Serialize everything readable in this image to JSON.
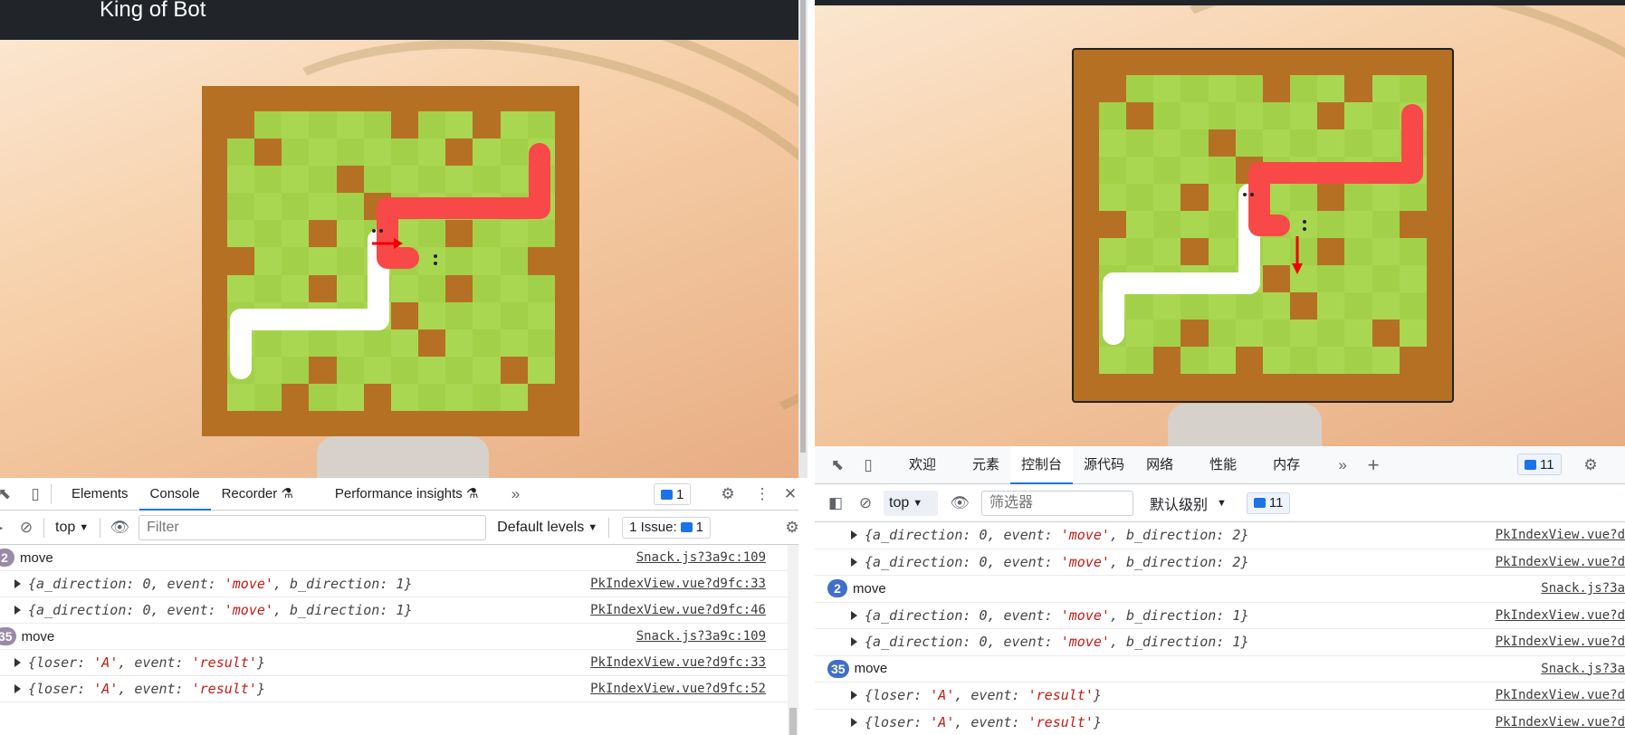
{
  "left": {
    "navbar_brand": "King of Bot",
    "devtools": {
      "tabs": [
        "Elements",
        "Console",
        "Recorder",
        "Performance insights"
      ],
      "issues_count": "1",
      "context": "top",
      "filter_placeholder": "Filter",
      "levels": "Default levels",
      "issues_label": "1 Issue:",
      "issues_badge": "1",
      "rows": [
        {
          "count": "2",
          "text": "move",
          "src": "Snack.js?3a9c:109"
        },
        {
          "obj": [
            "a_direction",
            "0",
            "move",
            "b_direction",
            "1"
          ],
          "src": "PkIndexView.vue?d9fc:33"
        },
        {
          "obj": [
            "a_direction",
            "0",
            "move",
            "b_direction",
            "1"
          ],
          "src": "PkIndexView.vue?d9fc:46"
        },
        {
          "count": "35",
          "text": "move",
          "src": "Snack.js?3a9c:109"
        },
        {
          "res": [
            "loser",
            "A",
            "result"
          ],
          "src": "PkIndexView.vue?d9fc:33"
        },
        {
          "res": [
            "loser",
            "A",
            "result"
          ],
          "src": "PkIndexView.vue?d9fc:52"
        }
      ]
    }
  },
  "right": {
    "devtools": {
      "tabs": [
        "欢迎",
        "元素",
        "控制台",
        "源代码",
        "网络",
        "性能",
        "内存"
      ],
      "issues_count": "11",
      "context": "top",
      "filter_placeholder": "筛选器",
      "levels": "默认级别",
      "msg_count": "11",
      "rows": [
        {
          "obj": [
            "a_direction",
            "0",
            "move",
            "b_direction",
            "2"
          ],
          "src": "PkIndexView.vue?d"
        },
        {
          "obj": [
            "a_direction",
            "0",
            "move",
            "b_direction",
            "2"
          ],
          "src": "PkIndexView.vue?d"
        },
        {
          "count": "2",
          "text": "move",
          "src": "Snack.js?3a"
        },
        {
          "obj": [
            "a_direction",
            "0",
            "move",
            "b_direction",
            "1"
          ],
          "src": "PkIndexView.vue?d"
        },
        {
          "obj": [
            "a_direction",
            "0",
            "move",
            "b_direction",
            "1"
          ],
          "src": "PkIndexView.vue?d"
        },
        {
          "count": "35",
          "text": "move",
          "src": "Snack.js?3a"
        },
        {
          "res": [
            "loser",
            "A",
            "result"
          ],
          "src": "PkIndexView.vue?d"
        },
        {
          "res": [
            "loser",
            "A",
            "result"
          ],
          "src": "PkIndexView.vue?d"
        }
      ]
    }
  },
  "colors": {
    "wall": "#b57024",
    "grass_light": "#aad751",
    "grass_dark": "#a2d149",
    "snake_a": "#ffffff",
    "snake_b": "#f94848",
    "accent": "#1a73e8"
  },
  "icons": [
    "inspect-icon",
    "device-icon",
    "more-tabs-icon",
    "gear-icon",
    "kebab-icon",
    "close-icon",
    "sidebar-icon",
    "clear-icon",
    "eye-icon",
    "plus-icon",
    "arrow-icon"
  ]
}
